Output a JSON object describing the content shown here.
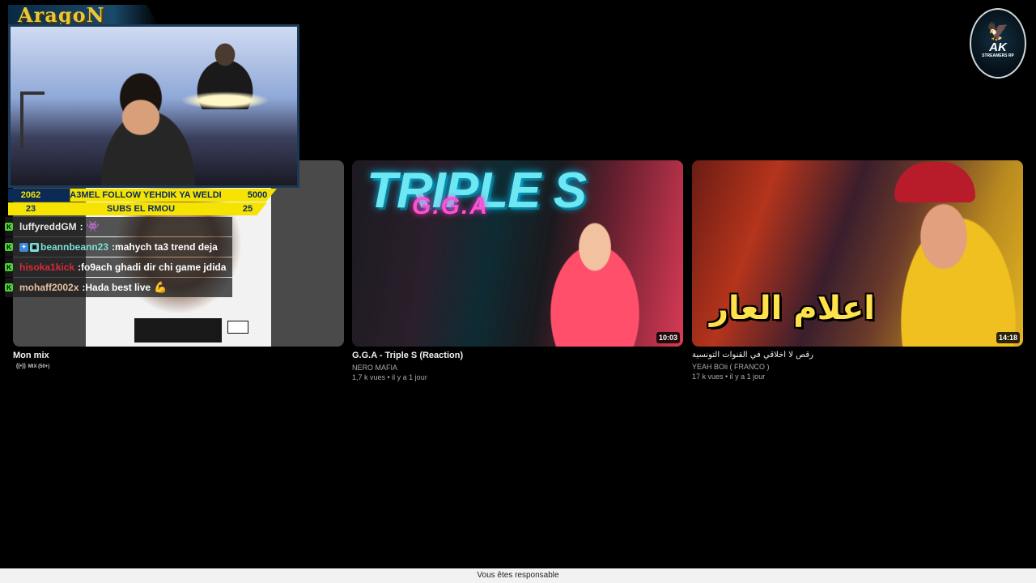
{
  "videos": [
    {
      "title": "Mon mix",
      "badge": "MIX (50+)",
      "thumbnail_icon": "album-cover-image"
    },
    {
      "title": "G.G.A - Triple S (Reaction)",
      "channel": "NERO MAFIA",
      "meta": "1,7 k vues • il y a 1 jour",
      "duration": "10:03",
      "thumb_title": "TRIPLE S",
      "thumb_sub": "G.G.A"
    },
    {
      "title": "رقص لا أخلاقي في القنوات التونسية",
      "channel": "YEAH BOii ( FRANCO )",
      "meta": "17 k vues • il y a 1 jour",
      "duration": "14:18",
      "thumb_text": "اعلام العار"
    }
  ],
  "overlay": {
    "logo": "AragoN",
    "goal_row1": {
      "left": "2062",
      "text": "A3MEL FOLLOW YEHDIK YA WELDI",
      "right": "5000"
    },
    "goal_row2": {
      "left": "23",
      "text": "SUBS EL RMOU",
      "right": "25"
    },
    "chat": [
      {
        "user": "luffyreddGM",
        "sep": " :",
        "text": "",
        "user_color": "#e8e8e8",
        "has_emote": true,
        "emote": "👾"
      },
      {
        "user": "beannbeann23",
        "sep": " :",
        "text": " mahych ta3 trend deja",
        "user_color": "#7be0d8",
        "badges": true
      },
      {
        "user": "hisoka1kick",
        "sep": " :",
        "text": " fo9ach ghadi dir chi game jdida",
        "user_color": "#d82a3a"
      },
      {
        "user": "mohaff2002x",
        "sep": " :",
        "text": " Hada best live",
        "user_color": "#e8c0a0",
        "has_emote": true,
        "emote": "💪"
      }
    ]
  },
  "channel_logo": {
    "big": "AK",
    "small": "STREAMERS RP"
  },
  "footer": "Vous êtes responsable",
  "colors": {
    "accent_yellow": "#f6e400",
    "kick_green": "#4cd137"
  }
}
